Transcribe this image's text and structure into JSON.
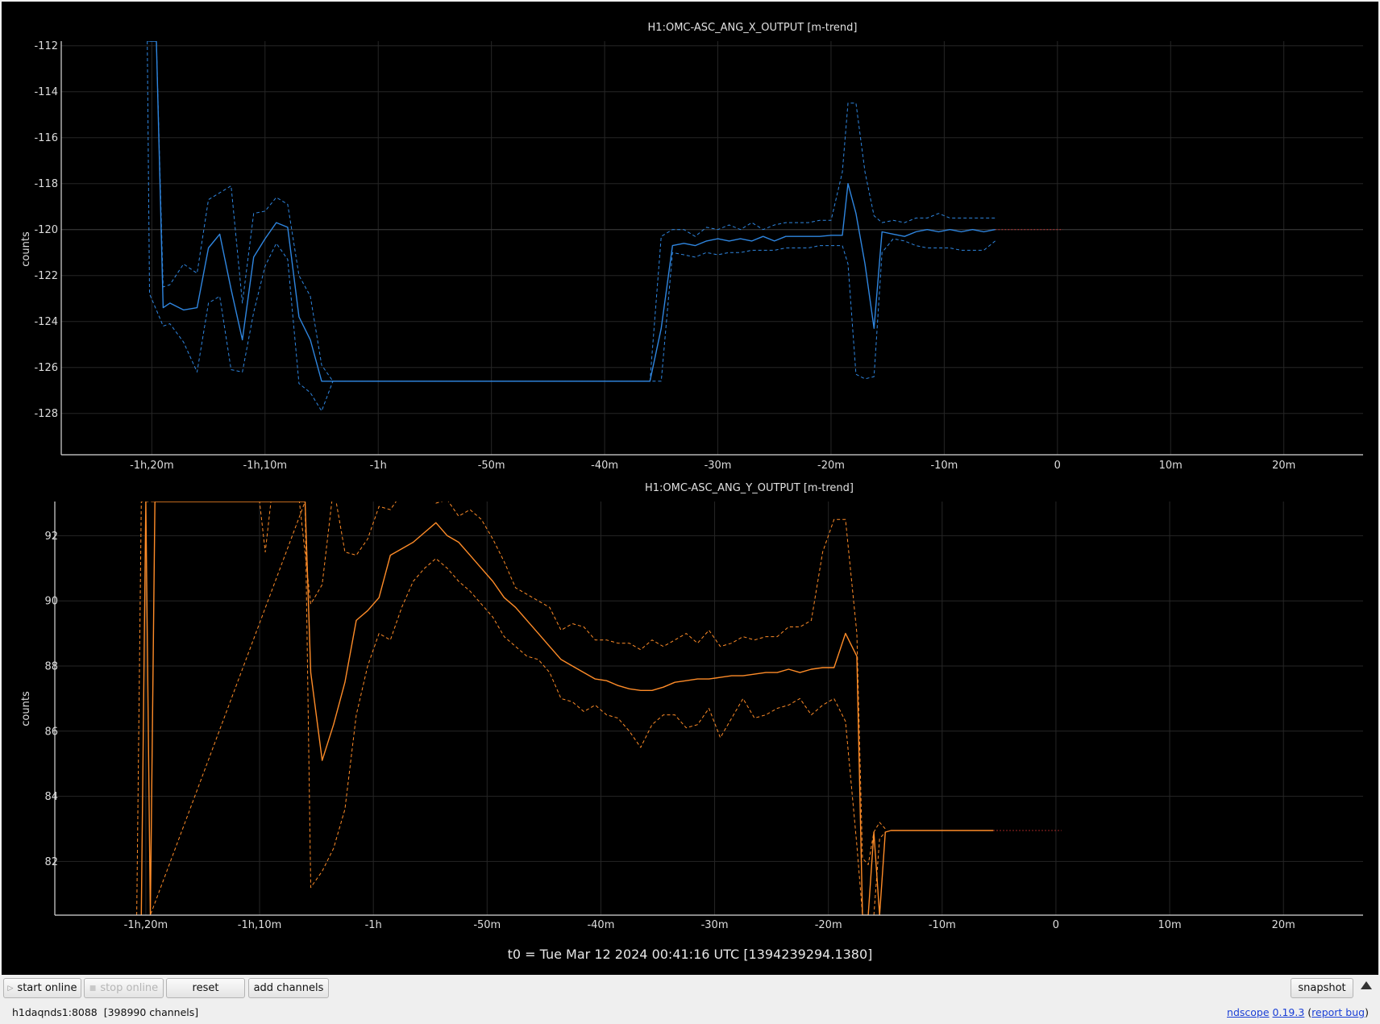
{
  "t0_label": "t0 = Tue Mar 12 2024 00:41:16 UTC [1394239294.1380]",
  "toolbar": {
    "start_online": "start online",
    "stop_online": "stop online",
    "reset": "reset",
    "add_channels": "add channels",
    "snapshot": "snapshot"
  },
  "status": {
    "server": "h1daqnds1:8088",
    "channels": "[398990 channels]",
    "app_name": "ndscope",
    "version": "0.19.3",
    "report_bug": "report bug"
  },
  "colors": {
    "background": "#000000",
    "series_x": "#2f86e0",
    "series_y": "#ff8c28",
    "axis": "#d9d9d9",
    "grid": "#262626",
    "reference_line": "#343434"
  },
  "chart_data": [
    {
      "type": "line",
      "title": "H1:OMC-ASC_ANG_X_OUTPUT [m-trend]",
      "ylabel": "counts",
      "xlim": [
        -88,
        27
      ],
      "ylim": [
        -129.8,
        -111.8
      ],
      "grid": true,
      "x_tick_values": [
        -80,
        -70,
        -60,
        -50,
        -40,
        -30,
        -20,
        -10,
        0,
        10,
        20
      ],
      "x_tick_labels": [
        "-1h,20m",
        "-1h,10m",
        "-1h",
        "-50m",
        "-40m",
        "-30m",
        "-20m",
        "-10m",
        "0",
        "10m",
        "20m"
      ],
      "y_ticks": [
        -112,
        -114,
        -116,
        -118,
        -120,
        -122,
        -124,
        -126,
        -128
      ],
      "reference_y": -120,
      "series": [
        {
          "role": "mean",
          "style": "solid",
          "color": "#2f86e0",
          "x": [
            -80.2,
            -79.6,
            -79.0,
            -78.4,
            -77.2,
            -76.0,
            -75.0,
            -74.0,
            -73.0,
            -72.0,
            -71.0,
            -70.0,
            -69.0,
            -68.0,
            -67.0,
            -66.0,
            -65.0,
            -64.0,
            -63.0,
            -62.0,
            -61.0,
            -60.0,
            -50.0,
            -40.0,
            -37.0,
            -36.0,
            -35.0,
            -34.0,
            -33.0,
            -32.0,
            -31.0,
            -30.0,
            -29.0,
            -28.0,
            -27.0,
            -26.0,
            -25.0,
            -24.0,
            -23.0,
            -22.0,
            -21.0,
            -20.0,
            -19.0,
            -18.5,
            -17.8,
            -17.0,
            -16.2,
            -15.5,
            -14.5,
            -13.5,
            -12.5,
            -11.5,
            -10.5,
            -9.5,
            -8.5,
            -7.5,
            -6.5,
            -5.5
          ],
          "y": [
            -111.8,
            -111.8,
            -123.4,
            -123.2,
            -123.5,
            -123.4,
            -120.8,
            -120.2,
            -122.6,
            -124.8,
            -121.2,
            -120.4,
            -119.7,
            -119.9,
            -123.8,
            -124.8,
            -126.6,
            -126.6,
            -126.6,
            -126.6,
            -126.6,
            -126.6,
            -126.6,
            -126.6,
            -126.6,
            -126.6,
            -124.3,
            -120.7,
            -120.6,
            -120.7,
            -120.5,
            -120.4,
            -120.5,
            -120.4,
            -120.5,
            -120.3,
            -120.5,
            -120.3,
            -120.3,
            -120.3,
            -120.3,
            -120.25,
            -120.25,
            -118.0,
            -119.3,
            -121.5,
            -124.3,
            -120.1,
            -120.2,
            -120.3,
            -120.1,
            -120.0,
            -120.1,
            -120.0,
            -120.1,
            -120.0,
            -120.1,
            -120.0
          ]
        },
        {
          "role": "max",
          "style": "dashed",
          "color": "#2f86e0",
          "x": [
            -80.4,
            -80.2,
            -79.6,
            -79.0,
            -78.4,
            -77.2,
            -76.0,
            -75.0,
            -74.0,
            -73.0,
            -72.0,
            -71.0,
            -70.0,
            -69.0,
            -68.0,
            -67.0,
            -66.0,
            -65.0,
            -64.0,
            -63.0,
            -62.0,
            -61.0,
            -60.0,
            -50.0,
            -40.0,
            -37.0,
            -36.0,
            -35.0,
            -34.0,
            -33.0,
            -32.0,
            -31.0,
            -30.0,
            -29.0,
            -28.0,
            -27.0,
            -26.0,
            -25.0,
            -24.0,
            -23.0,
            -22.0,
            -21.0,
            -20.0,
            -19.0,
            -18.5,
            -17.8,
            -17.0,
            -16.2,
            -15.5,
            -14.5,
            -13.5,
            -12.5,
            -11.5,
            -10.5,
            -9.5,
            -8.5,
            -7.5,
            -6.5,
            -5.5
          ],
          "y": [
            -111.8,
            -111.8,
            -111.8,
            -122.5,
            -122.4,
            -121.5,
            -121.9,
            -118.7,
            -118.4,
            -118.1,
            -123.2,
            -119.3,
            -119.2,
            -118.6,
            -118.9,
            -122.0,
            -122.9,
            -125.9,
            -126.6,
            -126.6,
            -126.6,
            -126.6,
            -126.6,
            -126.6,
            -126.6,
            -126.6,
            -126.6,
            -120.3,
            -120.0,
            -120.0,
            -120.3,
            -119.9,
            -120.0,
            -119.8,
            -120.0,
            -119.7,
            -120.0,
            -119.8,
            -119.7,
            -119.7,
            -119.7,
            -119.6,
            -119.6,
            -117.5,
            -114.5,
            -114.5,
            -117.5,
            -119.4,
            -119.7,
            -119.6,
            -119.7,
            -119.5,
            -119.5,
            -119.3,
            -119.5,
            -119.5,
            -119.5,
            -119.5,
            -119.5
          ]
        },
        {
          "role": "min",
          "style": "dashed",
          "color": "#2f86e0",
          "x": [
            -80.4,
            -80.2,
            -79.6,
            -79.0,
            -78.4,
            -77.2,
            -76.0,
            -75.0,
            -74.0,
            -73.0,
            -72.0,
            -71.0,
            -70.0,
            -69.0,
            -68.0,
            -67.0,
            -66.0,
            -65.0,
            -64.0,
            -63.0,
            -62.0,
            -61.0,
            -60.0,
            -50.0,
            -40.0,
            -37.0,
            -36.0,
            -35.0,
            -34.0,
            -33.0,
            -32.0,
            -31.0,
            -30.0,
            -29.0,
            -28.0,
            -27.0,
            -26.0,
            -25.0,
            -24.0,
            -23.0,
            -22.0,
            -21.0,
            -20.0,
            -19.0,
            -18.5,
            -17.8,
            -17.0,
            -16.2,
            -15.5,
            -14.5,
            -13.5,
            -12.5,
            -11.5,
            -10.5,
            -9.5,
            -8.5,
            -7.5,
            -6.5,
            -5.5
          ],
          "y": [
            -111.8,
            -122.8,
            -123.5,
            -124.2,
            -124.1,
            -124.9,
            -126.2,
            -123.2,
            -122.9,
            -126.1,
            -126.2,
            -123.6,
            -121.6,
            -120.6,
            -121.3,
            -126.7,
            -127.1,
            -127.9,
            -126.6,
            -126.6,
            -126.6,
            -126.6,
            -126.6,
            -126.6,
            -126.6,
            -126.6,
            -126.6,
            -126.6,
            -121.0,
            -121.1,
            -121.2,
            -121.0,
            -121.1,
            -121.0,
            -121.0,
            -120.9,
            -120.9,
            -120.9,
            -120.8,
            -120.8,
            -120.8,
            -120.7,
            -120.7,
            -120.7,
            -121.5,
            -126.3,
            -126.5,
            -126.4,
            -121.0,
            -120.4,
            -120.5,
            -120.7,
            -120.8,
            -120.8,
            -120.8,
            -120.9,
            -120.9,
            -120.9,
            -120.5
          ]
        },
        {
          "role": "extension",
          "style": "dotted",
          "color": "#d2312f",
          "x": [
            -5.5,
            0.5
          ],
          "y": [
            -120.0,
            -120.0
          ]
        }
      ]
    },
    {
      "type": "line",
      "title": "H1:OMC-ASC_ANG_Y_OUTPUT [m-trend]",
      "ylabel": "counts",
      "xlim": [
        -88,
        27
      ],
      "ylim": [
        80.35,
        93.05
      ],
      "grid": true,
      "x_tick_values": [
        -80,
        -70,
        -60,
        -50,
        -40,
        -30,
        -20,
        -10,
        0,
        10,
        20
      ],
      "x_tick_labels": [
        "-1h,20m",
        "-1h,10m",
        "-1h",
        "-50m",
        "-40m",
        "-30m",
        "-20m",
        "-10m",
        "0",
        "10m",
        "20m"
      ],
      "y_ticks": [
        92,
        90,
        88,
        86,
        84,
        82
      ],
      "series": [
        {
          "role": "mean",
          "style": "solid",
          "color": "#ff8c28",
          "x": [
            -80.4,
            -80.0,
            -79.6,
            -79.2,
            -66.0,
            -65.5,
            -64.5,
            -63.5,
            -62.5,
            -61.5,
            -60.5,
            -59.5,
            -58.5,
            -57.5,
            -56.5,
            -55.5,
            -54.5,
            -53.5,
            -52.5,
            -51.5,
            -50.5,
            -49.5,
            -48.5,
            -47.5,
            -46.5,
            -45.5,
            -44.5,
            -43.5,
            -42.5,
            -41.5,
            -40.5,
            -39.5,
            -38.5,
            -37.5,
            -36.5,
            -35.5,
            -34.5,
            -33.5,
            -32.5,
            -31.5,
            -30.5,
            -29.5,
            -28.5,
            -27.5,
            -26.5,
            -25.5,
            -24.5,
            -23.5,
            -22.5,
            -21.5,
            -20.5,
            -19.5,
            -18.5,
            -17.5,
            -17.0,
            -16.5,
            -16.0,
            -15.5,
            -15.0,
            -14.5,
            -13.5,
            -12.0,
            -10.0,
            -8.0,
            -5.5
          ],
          "y": [
            80.35,
            93.05,
            80.35,
            93.05,
            93.05,
            87.8,
            85.1,
            86.2,
            87.5,
            89.4,
            89.7,
            90.1,
            91.4,
            91.6,
            91.8,
            92.1,
            92.4,
            92.0,
            91.8,
            91.4,
            91.0,
            90.6,
            90.1,
            89.8,
            89.4,
            89.0,
            88.6,
            88.2,
            88.0,
            87.8,
            87.6,
            87.55,
            87.4,
            87.3,
            87.25,
            87.25,
            87.35,
            87.5,
            87.55,
            87.6,
            87.6,
            87.65,
            87.7,
            87.7,
            87.75,
            87.8,
            87.8,
            87.9,
            87.8,
            87.9,
            87.95,
            87.95,
            89.0,
            88.3,
            80.35,
            80.35,
            82.9,
            80.35,
            82.9,
            82.95,
            82.95,
            82.95,
            82.95,
            82.95,
            82.95
          ]
        },
        {
          "role": "max",
          "style": "dashed",
          "color": "#ff8c28",
          "x": [
            -80.8,
            -80.4,
            -78.8,
            -78.4,
            -70.0,
            -69.5,
            -69.0,
            -68.5,
            -66.5,
            -65.5,
            -64.5,
            -63.5,
            -62.5,
            -61.5,
            -60.5,
            -59.5,
            -58.5,
            -57.5,
            -56.5,
            -55.5,
            -54.5,
            -53.5,
            -52.5,
            -51.5,
            -50.5,
            -49.5,
            -48.5,
            -47.5,
            -46.5,
            -45.5,
            -44.5,
            -43.5,
            -42.5,
            -41.5,
            -40.5,
            -39.5,
            -38.5,
            -37.5,
            -36.5,
            -35.5,
            -34.5,
            -33.5,
            -32.5,
            -31.5,
            -30.5,
            -29.5,
            -28.5,
            -27.5,
            -26.5,
            -25.5,
            -24.5,
            -23.5,
            -22.5,
            -21.5,
            -20.5,
            -19.5,
            -18.5,
            -17.5,
            -17.0,
            -16.5,
            -16.0,
            -15.5,
            -15.0
          ],
          "y": [
            80.35,
            93.05,
            93.05,
            93.05,
            93.05,
            91.5,
            93.05,
            93.05,
            93.05,
            89.9,
            90.5,
            93.5,
            91.5,
            91.4,
            91.9,
            92.9,
            92.8,
            93.3,
            93.6,
            93.3,
            93.0,
            93.1,
            92.6,
            92.8,
            92.5,
            91.9,
            91.2,
            90.4,
            90.2,
            90.0,
            89.8,
            89.1,
            89.3,
            89.2,
            88.8,
            88.8,
            88.7,
            88.7,
            88.5,
            88.8,
            88.6,
            88.8,
            89.0,
            88.7,
            89.1,
            88.6,
            88.7,
            88.9,
            88.8,
            88.9,
            88.9,
            89.2,
            89.2,
            89.4,
            91.5,
            92.5,
            92.5,
            89.0,
            82.1,
            81.9,
            82.9,
            83.2,
            83.0
          ]
        },
        {
          "role": "min",
          "style": "dashed",
          "color": "#ff8c28",
          "x": [
            -80.0,
            -79.6,
            -66.0,
            -65.5,
            -64.5,
            -63.5,
            -62.5,
            -61.5,
            -60.5,
            -59.5,
            -58.5,
            -57.5,
            -56.5,
            -55.5,
            -54.5,
            -53.5,
            -52.5,
            -51.5,
            -50.5,
            -49.5,
            -48.5,
            -47.5,
            -46.5,
            -45.5,
            -44.5,
            -43.5,
            -42.5,
            -41.5,
            -40.5,
            -39.5,
            -38.5,
            -37.5,
            -36.5,
            -35.5,
            -34.5,
            -33.5,
            -32.5,
            -31.5,
            -30.5,
            -29.5,
            -28.5,
            -27.5,
            -26.5,
            -25.5,
            -24.5,
            -23.5,
            -22.5,
            -21.5,
            -20.5,
            -19.5,
            -18.5,
            -17.5,
            -17.0,
            -16.5,
            -16.0,
            -15.5,
            -15.0
          ],
          "y": [
            80.35,
            80.35,
            93.05,
            81.2,
            81.7,
            82.4,
            83.6,
            86.5,
            88.0,
            89.0,
            88.8,
            89.8,
            90.6,
            91.0,
            91.3,
            91.0,
            90.6,
            90.3,
            89.9,
            89.5,
            88.9,
            88.6,
            88.3,
            88.2,
            87.8,
            87.0,
            86.9,
            86.6,
            86.8,
            86.5,
            86.4,
            86.0,
            85.5,
            86.2,
            86.5,
            86.5,
            86.1,
            86.2,
            86.7,
            85.8,
            86.4,
            87.0,
            86.4,
            86.5,
            86.7,
            86.8,
            87.0,
            86.5,
            86.8,
            87.0,
            86.3,
            82.5,
            80.35,
            80.35,
            80.35,
            82.7,
            82.9
          ]
        },
        {
          "role": "extension",
          "style": "dotted",
          "color": "#d2312f",
          "x": [
            -5.5,
            0.5
          ],
          "y": [
            82.95,
            82.95
          ]
        }
      ]
    }
  ]
}
